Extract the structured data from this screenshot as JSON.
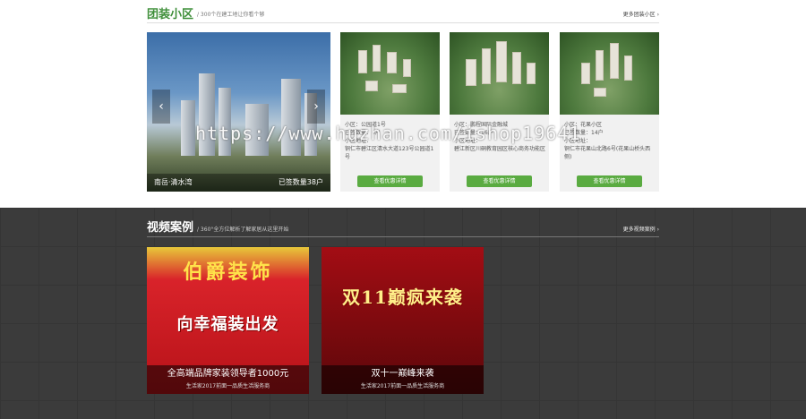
{
  "estates": {
    "title": "团装小区",
    "subtitle": "/ 300个在建工地让你看个够",
    "more": "更多团装小区",
    "featured": {
      "name": "南岳·清水湾",
      "count": "已签数量38户"
    },
    "cards": [
      {
        "line1": "小区：公园道1号",
        "line2": "已签数量：8户",
        "line3": "小区地址：",
        "line4": "铜仁市碧江区清水大道123号公园道1号",
        "button": "查看优惠详情"
      },
      {
        "line1": "小区：鹏程国际金融城",
        "line2": "已签数量：16户",
        "line3": "小区地址：",
        "line4": "碧江新区川硐教育园区核心商务功能区",
        "button": "查看优惠详情"
      },
      {
        "line1": "小区：花果小区",
        "line2": "已签数量：14户",
        "line3": "小区地址：",
        "line4": "铜仁市花果山北路6号(花果山桥头西侧)",
        "button": "查看优惠详情"
      }
    ]
  },
  "videos": {
    "title": "视频案例",
    "subtitle": "/ 360°全方位解析了解家居从这里开始",
    "more": "更多视频案例",
    "items": [
      {
        "headline": "伯爵装饰",
        "main": "向幸福装出发",
        "caption": "全高端品牌家装领导者1000元",
        "sub": "生活家2017前面一品质生活服务商"
      },
      {
        "headline": "",
        "main": "双11巅疯来袭",
        "caption": "双十一巅峰来袭",
        "sub": "生活家2017前面一品质生活服务商"
      }
    ]
  },
  "watermark": "https://www.huzhan.com/ishop19641",
  "colors": {
    "accent": "#5aab41",
    "title_green": "#3f8f3a",
    "dark_bg": "#3b3b3b"
  }
}
